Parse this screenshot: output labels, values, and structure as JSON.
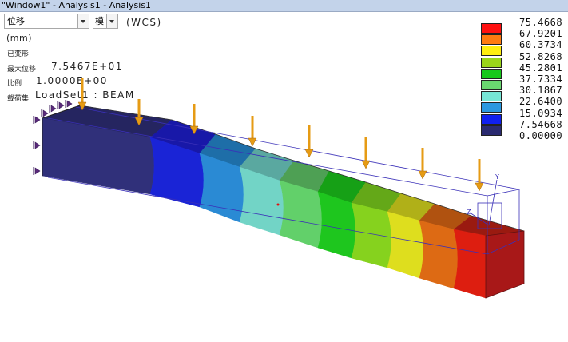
{
  "window": {
    "title": "\"Window1\" - Analysis1 - Analysis1"
  },
  "toolbar": {
    "quantity_value": "位移",
    "component_value": "模"
  },
  "info": {
    "coord_system": "(WCS)",
    "units": "(mm)",
    "deformed_label": "已变形",
    "max_label": "最大位移",
    "max_value": "7.5467E+01",
    "scale_label": "比例",
    "scale_value": "1.0000E+00",
    "loadset_label": "载荷集:",
    "loadset_value": "LoadSet1 :  BEAM"
  },
  "legend": {
    "labels": [
      "75.4668",
      "67.9201",
      "60.3734",
      "52.8268",
      "45.2801",
      "37.7334",
      "30.1867",
      "22.6400",
      "15.0934",
      "7.54668",
      "0.00000"
    ],
    "colors": [
      "#ff1010",
      "#ff7a10",
      "#ffee10",
      "#9ad41a",
      "#16c81a",
      "#6ad870",
      "#76e6d6",
      "#2a98e0",
      "#1020ee",
      "#2a2a70"
    ]
  },
  "model": {
    "band_colors": [
      "#30307a",
      "#1a24d6",
      "#2a8ad4",
      "#72d4c6",
      "#62d06a",
      "#1ec61e",
      "#86d21e",
      "#dede1e",
      "#dd6a14",
      "#dd1e10"
    ],
    "top_colors": [
      "#252560",
      "#1818a8",
      "#1e6ea8",
      "#5aa8a0",
      "#4ea054",
      "#16a016",
      "#64a818",
      "#b0b018",
      "#b05210",
      "#9a1a10"
    ],
    "end_face_color": "#a81818",
    "load_color": "#e69b14",
    "wire_color": "#3a30b8"
  }
}
